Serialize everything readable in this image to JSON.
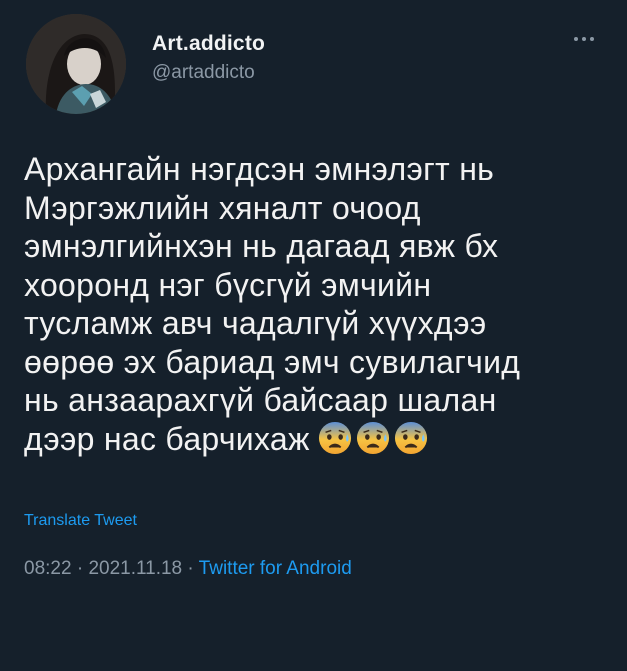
{
  "author": {
    "display_name": "Art.addicto",
    "handle": "@artaddicto"
  },
  "menu": {
    "icon": "more-horizontal-icon"
  },
  "tweet": {
    "text": "Архангайн нэгдсэн эмнэлэгт нь\nМэргэжлийн хяналт очоод\nэмнэлгийнхэн нь дагаад явж бх\nхооронд нэг бүсгүй эмчийн\nтусламж авч чадалгүй хүүхдээ\nөөрөө эх бариад эмч сувилагчид\nнь анзаарахгүй байсаар шалан\nдээр нас барчихаж",
    "emojis": [
      "anxious-face-with-sweat-emoji",
      "anxious-face-with-sweat-emoji",
      "anxious-face-with-sweat-emoji"
    ]
  },
  "translate_label": "Translate Tweet",
  "meta": {
    "time": "08:22",
    "separator": " · ",
    "date": "2021.11.18",
    "source": "Twitter for Android"
  },
  "colors": {
    "background": "#15202b",
    "accent": "#1d9bf0",
    "secondary_text": "#8b98a5"
  }
}
